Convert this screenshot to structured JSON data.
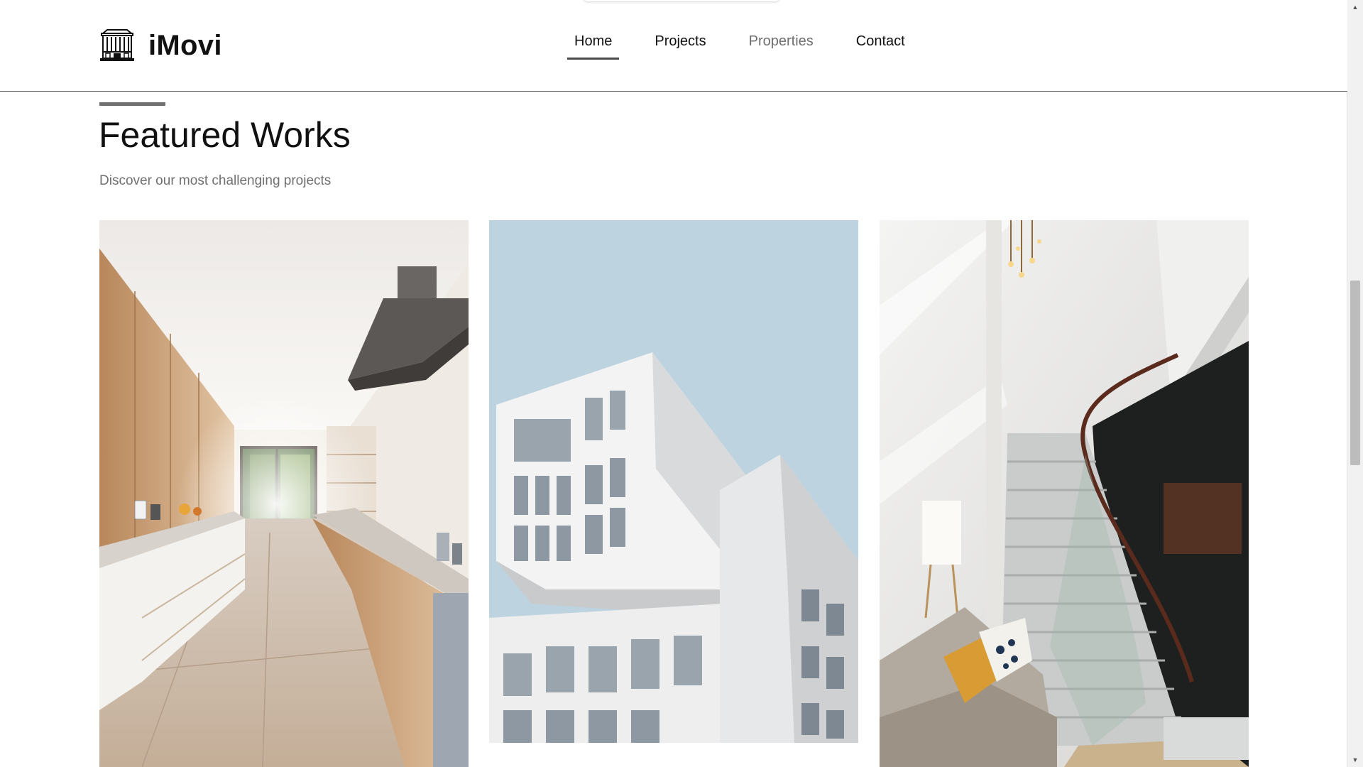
{
  "brand": {
    "name": "iMovi",
    "logo_icon": "building-icon"
  },
  "nav": {
    "items": [
      {
        "label": "Home",
        "state": "active"
      },
      {
        "label": "Projects",
        "state": "normal"
      },
      {
        "label": "Properties",
        "state": "muted"
      },
      {
        "label": "Contact",
        "state": "normal"
      }
    ]
  },
  "section": {
    "title": "Featured Works",
    "subtitle": "Discover our most challenging projects"
  },
  "gallery": {
    "images": [
      {
        "subject": "modern-kitchen-interior"
      },
      {
        "subject": "white-modern-building-exterior"
      },
      {
        "subject": "lobby-staircase-with-sofa"
      }
    ]
  },
  "colors": {
    "text": "#111111",
    "muted_text": "#707070",
    "accent_bar": "#6f6f6f",
    "header_border": "#5a5a5a",
    "sky": "#bcd3e0"
  },
  "scrollbar": {
    "up_icon": "chevron-up-icon",
    "down_icon": "chevron-down-icon"
  }
}
